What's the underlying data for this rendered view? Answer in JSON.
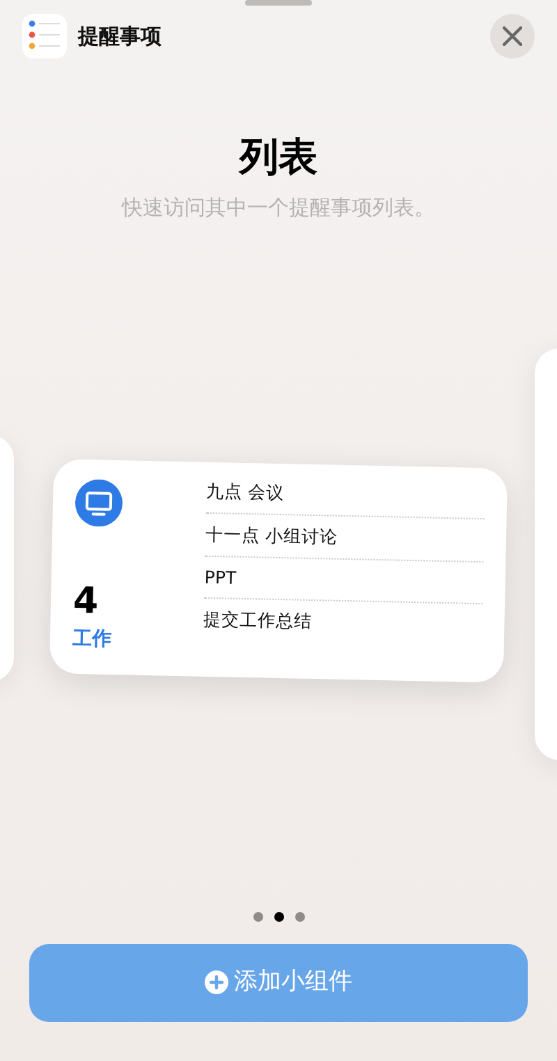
{
  "app": {
    "title": "提醒事项"
  },
  "header": {
    "title": "列表",
    "subtitle": "快速访问其中一个提醒事项列表。"
  },
  "widget": {
    "count": "4",
    "list_name": "工作",
    "items": [
      "九点 会议",
      "十一点 小组讨论",
      "PPT",
      "提交工作总结"
    ]
  },
  "pages": [
    {
      "selected": false
    },
    {
      "selected": true
    },
    {
      "selected": false
    }
  ],
  "add_button": {
    "label": "添加小组件"
  }
}
